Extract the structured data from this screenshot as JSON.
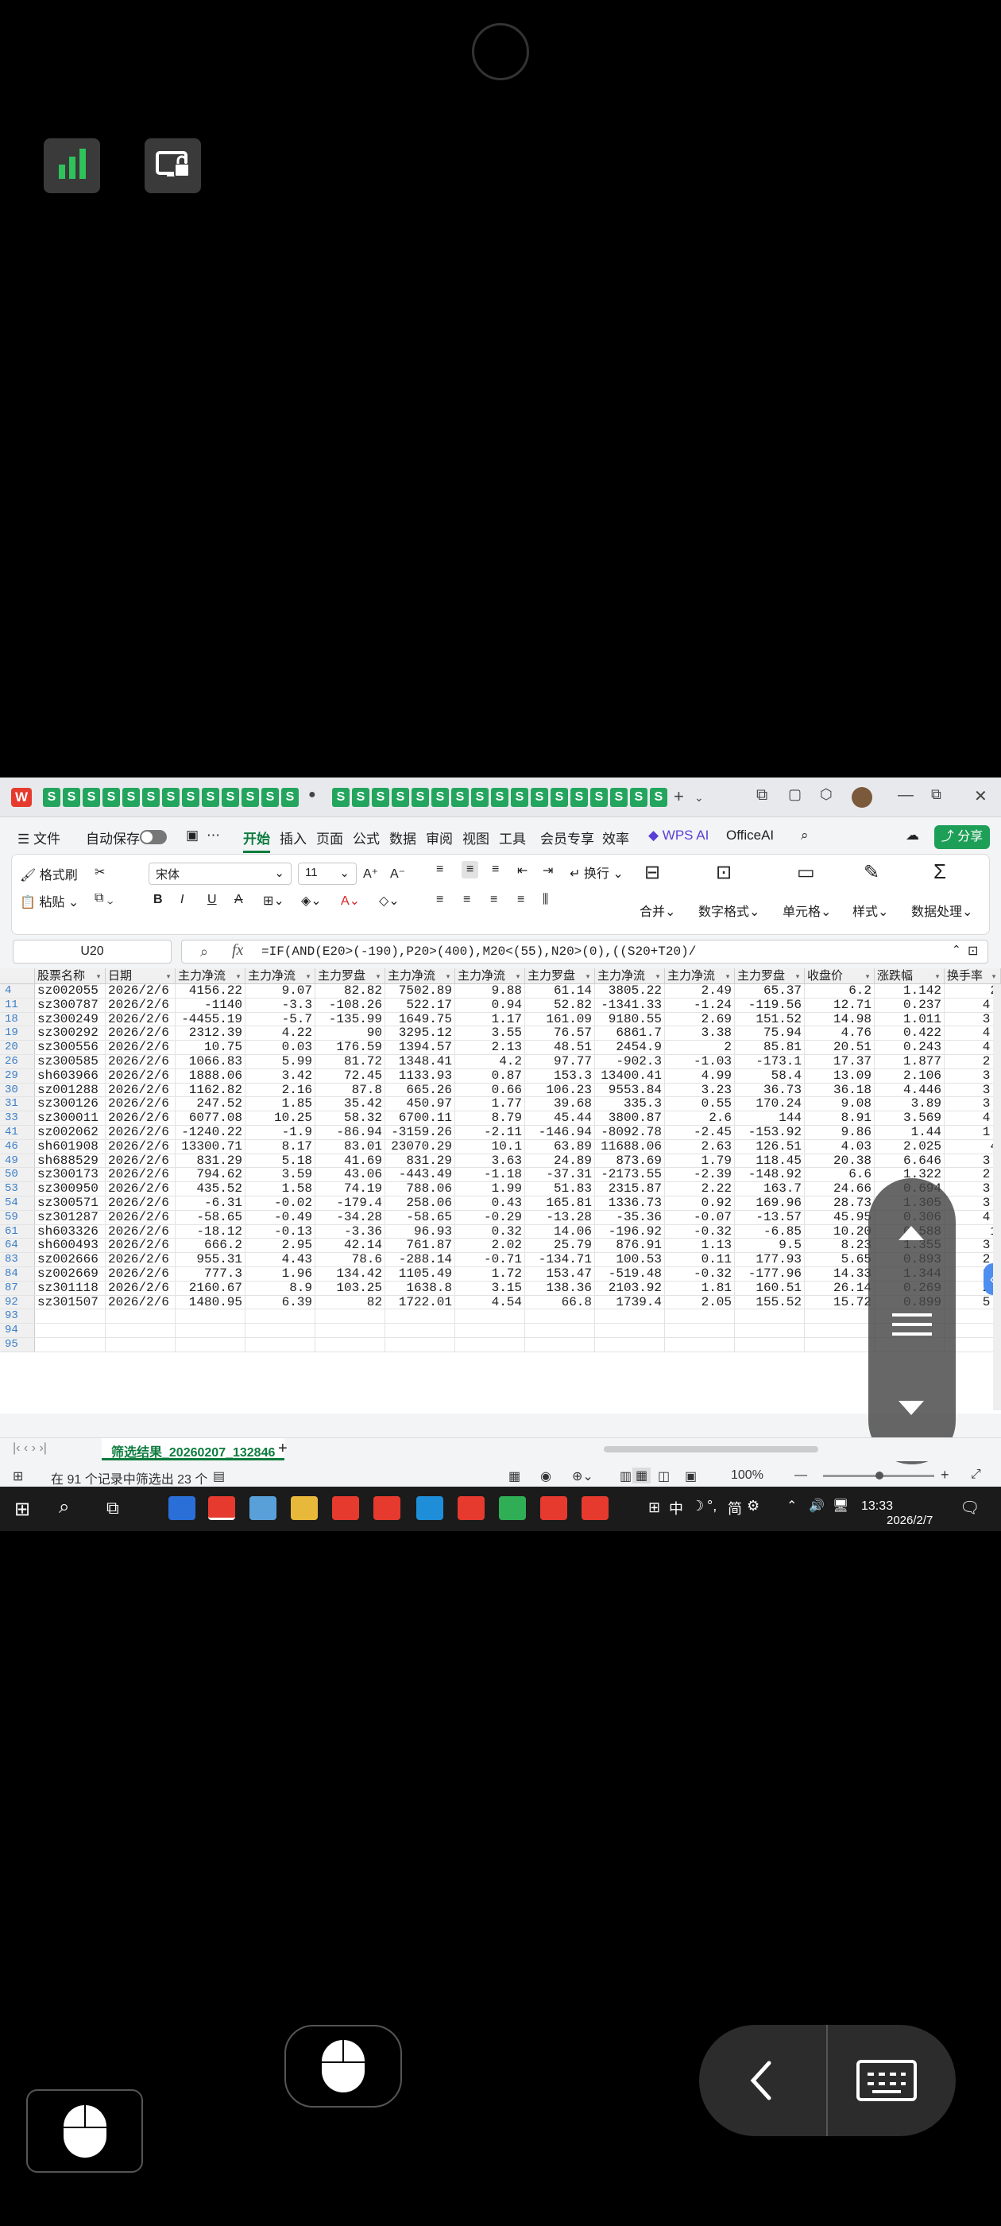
{
  "app": {
    "brand_letter": "W",
    "sheet_tab_letter": "S",
    "menu": [
      "文件",
      "自动保存",
      "开始",
      "插入",
      "页面",
      "公式",
      "数据",
      "审阅",
      "视图",
      "工具",
      "会员专享",
      "效率",
      "WPS AI",
      "OfficeAI"
    ],
    "share_label": "分享",
    "ribbon": {
      "format_painter": "格式刷",
      "paste": "粘贴",
      "font_name": "宋体",
      "font_size": "11",
      "wrap": "换行",
      "merge": "合并",
      "number_format": "数字格式",
      "cell": "单元格",
      "style": "样式",
      "data_process": "数据处理"
    },
    "name_box": "U20",
    "fx": "fx",
    "formula": "=IF(AND(E20>(-190),P20>(400),M20<(55),N20>(0),((S20+T20)/"
  },
  "sheet": {
    "columns": [
      "股票名称",
      "日期",
      "主力净流",
      "主力净流",
      "主力罗盘",
      "主力净流",
      "主力净流",
      "主力罗盘",
      "主力净流",
      "主力净流",
      "主力罗盘",
      "收盘价",
      "涨跌幅",
      "换手率"
    ],
    "rows": [
      {
        "n": "4",
        "cells": [
          "sz002055",
          "2026/2/6",
          "4156.22",
          "9.07",
          "82.82",
          "7502.89",
          "9.88",
          "61.14",
          "3805.22",
          "2.49",
          "65.37",
          "6.2",
          "1.142",
          "2"
        ]
      },
      {
        "n": "11",
        "cells": [
          "sz300787",
          "2026/2/6",
          "-1140",
          "-3.3",
          "-108.26",
          "522.17",
          "0.94",
          "52.82",
          "-1341.33",
          "-1.24",
          "-119.56",
          "12.71",
          "0.237",
          "4."
        ]
      },
      {
        "n": "18",
        "cells": [
          "sz300249",
          "2026/2/6",
          "-4455.19",
          "-5.7",
          "-135.99",
          "1649.75",
          "1.17",
          "161.09",
          "9180.55",
          "2.69",
          "151.52",
          "14.98",
          "1.011",
          "3."
        ]
      },
      {
        "n": "19",
        "cells": [
          "sz300292",
          "2026/2/6",
          "2312.39",
          "4.22",
          "90",
          "3295.12",
          "3.55",
          "76.57",
          "6861.7",
          "3.38",
          "75.94",
          "4.76",
          "0.422",
          "4."
        ]
      },
      {
        "n": "20",
        "cells": [
          "sz300556",
          "2026/2/6",
          "10.75",
          "0.03",
          "176.59",
          "1394.57",
          "2.13",
          "48.51",
          "2454.9",
          "2",
          "85.81",
          "20.51",
          "0.243",
          "4."
        ]
      },
      {
        "n": "26",
        "cells": [
          "sz300585",
          "2026/2/6",
          "1066.83",
          "5.99",
          "81.72",
          "1348.41",
          "4.2",
          "97.77",
          "-902.3",
          "-1.03",
          "-173.1",
          "17.37",
          "1.877",
          "2."
        ]
      },
      {
        "n": "29",
        "cells": [
          "sh603966",
          "2026/2/6",
          "1888.06",
          "3.42",
          "72.45",
          "1133.93",
          "0.87",
          "153.3",
          "13400.41",
          "4.99",
          "58.4",
          "13.09",
          "2.106",
          "3."
        ]
      },
      {
        "n": "30",
        "cells": [
          "sz001288",
          "2026/2/6",
          "1162.82",
          "2.16",
          "87.8",
          "665.26",
          "0.66",
          "106.23",
          "9553.84",
          "3.23",
          "36.73",
          "36.18",
          "4.446",
          "3."
        ]
      },
      {
        "n": "31",
        "cells": [
          "sz300126",
          "2026/2/6",
          "247.52",
          "1.85",
          "35.42",
          "450.97",
          "1.77",
          "39.68",
          "335.3",
          "0.55",
          "170.24",
          "9.08",
          "3.89",
          "3."
        ]
      },
      {
        "n": "33",
        "cells": [
          "sz300011",
          "2026/2/6",
          "6077.08",
          "10.25",
          "58.32",
          "6700.11",
          "8.79",
          "45.44",
          "3800.87",
          "2.6",
          "144",
          "8.91",
          "3.569",
          "4."
        ]
      },
      {
        "n": "41",
        "cells": [
          "sz002062",
          "2026/2/6",
          "-1240.22",
          "-1.9",
          "-86.94",
          "-3159.26",
          "-2.11",
          "-146.94",
          "-8092.78",
          "-2.45",
          "-153.92",
          "9.86",
          "1.44",
          "1."
        ]
      },
      {
        "n": "46",
        "cells": [
          "sh601908",
          "2026/2/6",
          "13300.71",
          "8.17",
          "83.01",
          "23070.29",
          "10.1",
          "63.89",
          "11688.06",
          "2.63",
          "126.51",
          "4.03",
          "2.025",
          "4"
        ]
      },
      {
        "n": "49",
        "cells": [
          "sh688529",
          "2026/2/6",
          "831.29",
          "5.18",
          "41.69",
          "831.29",
          "3.63",
          "24.89",
          "873.69",
          "1.79",
          "118.45",
          "20.38",
          "6.646",
          "3."
        ]
      },
      {
        "n": "50",
        "cells": [
          "sz300173",
          "2026/2/6",
          "794.62",
          "3.59",
          "43.06",
          "-443.49",
          "-1.18",
          "-37.31",
          "-2173.55",
          "-2.39",
          "-148.92",
          "6.6",
          "1.322",
          "2."
        ]
      },
      {
        "n": "53",
        "cells": [
          "sz300950",
          "2026/2/6",
          "435.52",
          "1.58",
          "74.19",
          "788.06",
          "1.99",
          "51.83",
          "2315.87",
          "2.22",
          "163.7",
          "24.66",
          "0.694",
          "3."
        ]
      },
      {
        "n": "54",
        "cells": [
          "sz300571",
          "2026/2/6",
          "-6.31",
          "-0.02",
          "-179.4",
          "258.06",
          "0.43",
          "165.81",
          "1336.73",
          "0.92",
          "169.96",
          "28.73",
          "1.305",
          "3."
        ]
      },
      {
        "n": "59",
        "cells": [
          "sz301287",
          "2026/2/6",
          "-58.65",
          "-0.49",
          "-34.28",
          "-58.65",
          "-0.29",
          "-13.28",
          "-35.36",
          "-0.07",
          "-13.57",
          "45.95",
          "0.306",
          "4."
        ]
      },
      {
        "n": "61",
        "cells": [
          "sh603326",
          "2026/2/6",
          "-18.12",
          "-0.13",
          "-3.36",
          "96.93",
          "0.32",
          "14.06",
          "-196.92",
          "-0.32",
          "-6.85",
          "10.20",
          "0.588",
          "1"
        ]
      },
      {
        "n": "64",
        "cells": [
          "sh600493",
          "2026/2/6",
          "666.2",
          "2.95",
          "42.14",
          "761.87",
          "2.02",
          "25.79",
          "876.91",
          "1.13",
          "9.5",
          "8.23",
          "1.355",
          "3."
        ]
      },
      {
        "n": "83",
        "cells": [
          "sz002666",
          "2026/2/6",
          "955.31",
          "4.43",
          "78.6",
          "-288.14",
          "-0.71",
          "-134.71",
          "100.53",
          "0.11",
          "177.93",
          "5.65",
          "0.893",
          "2."
        ]
      },
      {
        "n": "84",
        "cells": [
          "sz002669",
          "2026/2/6",
          "777.3",
          "1.96",
          "134.42",
          "1105.49",
          "1.72",
          "153.47",
          "-519.48",
          "-0.32",
          "-177.96",
          "14.33",
          "1.344",
          "3."
        ]
      },
      {
        "n": "87",
        "cells": [
          "sz301118",
          "2026/2/6",
          "2160.67",
          "8.9",
          "103.25",
          "1638.8",
          "3.15",
          "138.36",
          "2103.92",
          "1.81",
          "160.51",
          "26.14",
          "0.269",
          "2."
        ]
      },
      {
        "n": "92",
        "cells": [
          "sz301507",
          "2026/2/6",
          "1480.95",
          "6.39",
          "82",
          "1722.01",
          "4.54",
          "66.8",
          "1739.4",
          "2.05",
          "155.52",
          "15.72",
          "0.899",
          "5."
        ]
      },
      {
        "n": "93",
        "cells": []
      },
      {
        "n": "94",
        "cells": []
      },
      {
        "n": "95",
        "cells": []
      }
    ],
    "sheet_tab": "筛选结果_20260207_132846",
    "add_sheet": "+"
  },
  "status": {
    "filter_text": "在 91 个记录中筛选出 23 个",
    "zoom": "100%"
  },
  "taskbar": {
    "ime": "中",
    "ime2": "简",
    "time": "13:33",
    "date": "2026/2/7"
  }
}
